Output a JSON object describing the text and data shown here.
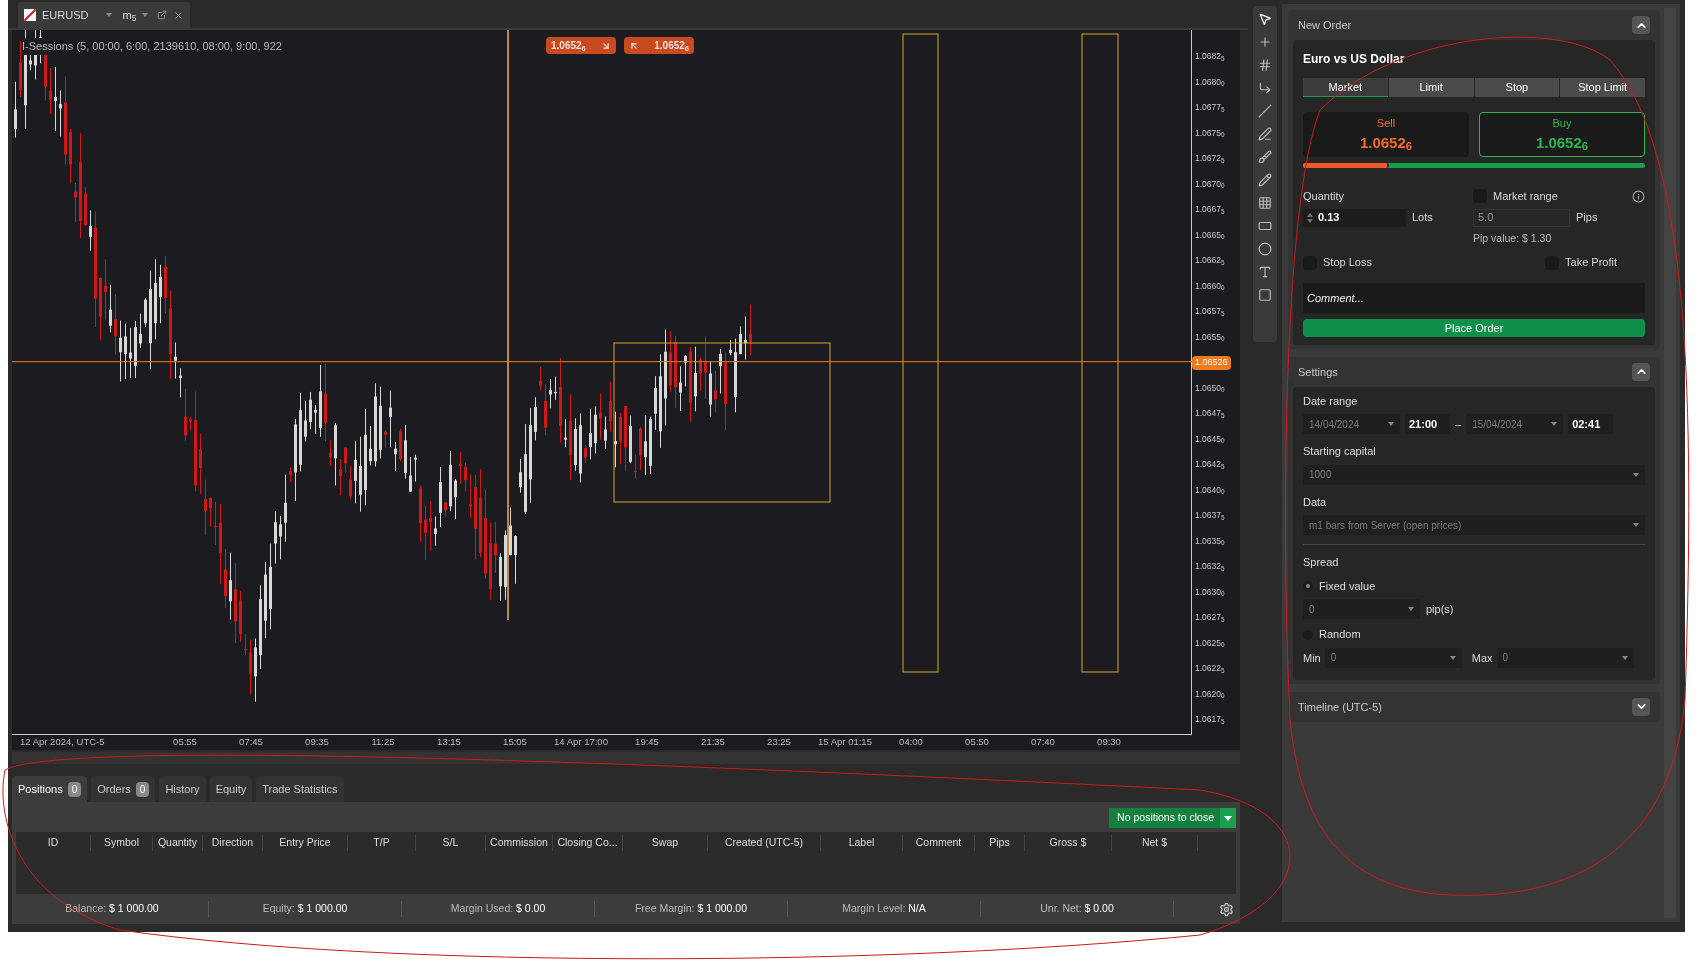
{
  "chart_tab": {
    "symbol": "EURUSD",
    "timeframe": "m$_{5}$"
  },
  "chart": {
    "indicator_label": "I-Sessions (5, 00:00, 6:00, 2139610, 08:00, 9:00, 922",
    "price_badges": [
      {
        "text": "1.0652$_{6}$",
        "kind": "sell"
      },
      {
        "text": "1.0652$_{6}$",
        "kind": "buy"
      }
    ],
    "price_ticks_above": [
      "1.0682$_{5}$",
      "1.0680$_{0}$",
      "1.0677$_{5}$",
      "1.0675$_{0}$",
      "1.0672$_{5}$",
      "1.0670$_{0}$",
      "1.0667$_{5}$",
      "1.0665$_{0}$",
      "1.0662$_{5}$",
      "1.0660$_{0}$",
      "1.0657$_{5}$",
      "1.0655$_{0}$"
    ],
    "current_price": "1.06526",
    "price_ticks_below": [
      "1.0650$_{0}$",
      "1.0647$_{5}$",
      "1.0645$_{0}$",
      "1.0642$_{5}$",
      "1.0640$_{0}$",
      "1.0637$_{5}$",
      "1.0635$_{0}$",
      "1.0632$_{5}$",
      "1.0630$_{0}$",
      "1.0627$_{5}$",
      "1.0625$_{0}$",
      "1.0622$_{5}$",
      "1.0620$_{0}$",
      "1.0617$_{5}$"
    ],
    "time_ticks": [
      "12 Apr 2024, UTC-5",
      "05:55",
      "07:45",
      "09:35",
      "11:25",
      "13:15",
      "15:05",
      "14 Apr 17:00",
      "19:45",
      "21:35",
      "23:25",
      "15 Apr 01:15",
      "04:00",
      "05:50",
      "07:40",
      "09:30"
    ]
  },
  "new_order": {
    "title": "New Order",
    "expanded": true,
    "instrument": "Euro vs US Dollar",
    "order_types": [
      {
        "label": "Market",
        "selected": true
      },
      {
        "label": "Limit",
        "selected": false
      },
      {
        "label": "Stop",
        "selected": false
      },
      {
        "label": "Stop Limit",
        "selected": false
      }
    ],
    "sides": [
      {
        "kind": "sell",
        "label": "Sell",
        "price": "1.0652$_{6}$",
        "selected": false
      },
      {
        "kind": "buy",
        "label": "Buy",
        "price": "1.0652$_{6}$",
        "selected": true
      }
    ],
    "spread_bar": {
      "level": 0.25
    },
    "quantity_label": "Quantity",
    "quantity": "0.13",
    "quantity_unit": "Lots",
    "market_range": {
      "label": "Market range",
      "checked": false
    },
    "range_value": "5.0",
    "range_unit": "Pips",
    "pip_value": "Pip value: $ 1.30",
    "stop_loss": {
      "label": "Stop Loss",
      "checked": false
    },
    "take_profit": {
      "label": "Take Profit",
      "checked": false
    },
    "comment_placeholder": "Comment...",
    "place_order": "Place Order"
  },
  "settings": {
    "title": "Settings",
    "expanded": true,
    "date_range_label": "Date range",
    "start_date": "14/04/2024",
    "start_time": "21:00",
    "range_dash": "–",
    "end_date": "15/04/2024",
    "end_time": "02:41",
    "starting_capital_label": "Starting capital",
    "starting_capital": "1000",
    "data_label": "Data",
    "data": "m1 bars from Server (open prices)",
    "spread_label": "Spread",
    "spread_modes": [
      {
        "label": "Fixed value",
        "selected": true
      },
      {
        "label": "Random",
        "selected": false
      }
    ],
    "fixed_value": "0",
    "fixed_unit": "pip(s)",
    "min_label": "Min",
    "min": "0",
    "max_label": "Max",
    "max": "0"
  },
  "timeline": {
    "title": "Timeline (UTC-5)",
    "expanded": false
  },
  "bottom_tabs": [
    {
      "label": "Positions",
      "count": "0",
      "selected": true
    },
    {
      "label": "Orders",
      "count": "0",
      "selected": false
    },
    {
      "label": "History",
      "selected": false
    },
    {
      "label": "Equity",
      "selected": false
    },
    {
      "label": "Trade Statistics",
      "selected": false
    }
  ],
  "close_button": "No positions to close",
  "columns": [
    "ID",
    "Symbol",
    "Quantity",
    "Direction",
    "Entry Price",
    "T/P",
    "S/L",
    "Commission",
    "Closing Co...",
    "Swap",
    "Created (UTC-5)",
    "Label",
    "Comment",
    "Pips",
    "Gross $",
    "Net $"
  ],
  "status_bar": [
    {
      "label": "Balance:",
      "value": "$ 1 000.00"
    },
    {
      "label": "Equity:",
      "value": "$ 1 000.00"
    },
    {
      "label": "Margin Used:",
      "value": "$ 0.00"
    },
    {
      "label": "Free Margin:",
      "value": "$ 1 000.00"
    },
    {
      "label": "Margin Level:",
      "value": "N/A"
    },
    {
      "label": "Unr. Net:",
      "value": "$ 0.00"
    }
  ]
}
